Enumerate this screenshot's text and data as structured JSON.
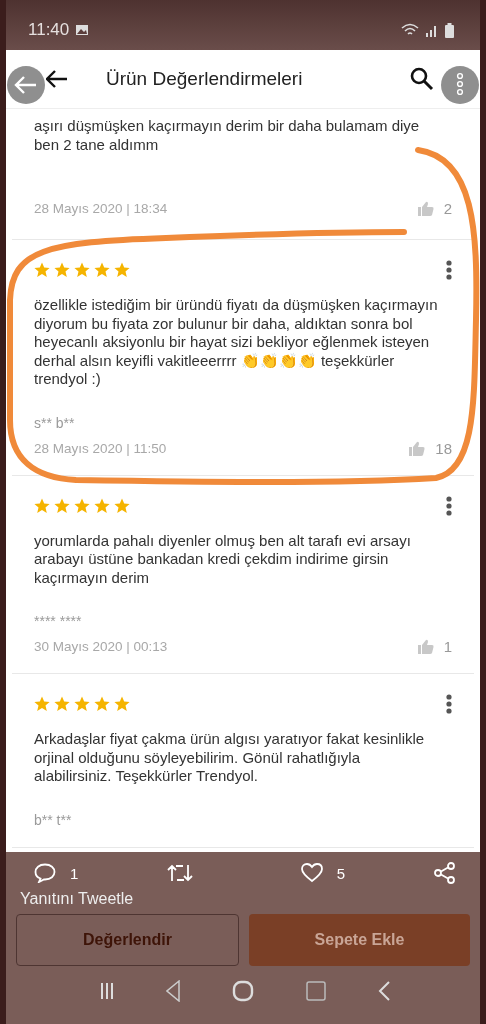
{
  "status_bar": {
    "time": "11:40"
  },
  "header": {
    "title": "Ürün Değerlendirmeleri"
  },
  "reviews": [
    {
      "text": "aşırı düşmüşken kaçırmayın derim bir daha bulamam diye ben 2 tane aldımm",
      "date": "28 Mayıs 2020 | 18:34",
      "likes": "2"
    },
    {
      "stars": 5,
      "text": "özellikle istediğim bir üründü fiyatı da düşmüşken kaçırmayın diyorum bu fiyata zor bulunur bir daha,  aldıktan sonra bol heyecanlı aksiyonlu bir hayat sizi bekliyor eğlenmek isteyen derhal alsın keyifli vakitleeerrrr 👏👏👏👏 teşekkürler trendyol :)",
      "author": "s** b**",
      "date": "28 Mayıs 2020 | 11:50",
      "likes": "18"
    },
    {
      "stars": 5,
      "text": "yorumlarda pahalı diyenler olmuş  ben alt tarafı evi arsayı arabayı üstüne bankadan kredi çekdim indirime girsin kaçırmayın derim",
      "author": "**** ****",
      "date": "30 Mayıs 2020 | 00:13",
      "likes": "1"
    },
    {
      "stars": 5,
      "text": "Arkadaşlar fiyat çakma ürün algısı yaratıyor fakat kesinlikle orjinal olduğunu söyleyebilirim. Gönül rahatlığıyla alabilirsiniz. Teşekkürler Trendyol.",
      "author": "b** t**"
    }
  ],
  "bottom_buttons": [
    {
      "kind": "outline",
      "label": "Değerlendir"
    },
    {
      "kind": "primary",
      "label": "Sepete Ekle"
    }
  ],
  "tweet_overlay": {
    "actions": [
      {
        "kind": "reply",
        "count": "1"
      },
      {
        "kind": "retweet"
      },
      {
        "kind": "like",
        "count": "5"
      },
      {
        "kind": "share"
      }
    ],
    "reply_prompt": "Yanıtını Tweetle"
  }
}
